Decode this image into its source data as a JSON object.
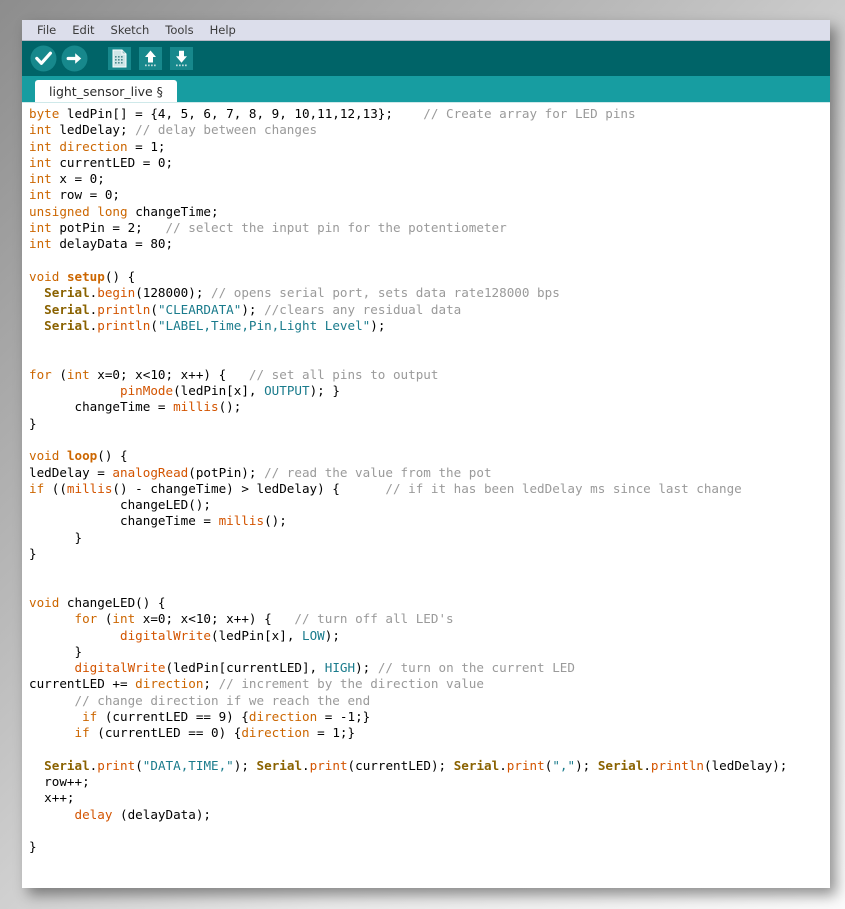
{
  "window": {
    "app": "Arduino IDE",
    "colors": {
      "toolbar_bg": "#006468",
      "tabbar_bg": "#179da1",
      "menubar_bg": "#dcdeeb",
      "editor_bg": "#ffffff",
      "keyword": "#cc6600",
      "function": "#d35400",
      "library": "#8a6200",
      "constant": "#1a7b8c",
      "string": "#1a7b8c",
      "comment": "#9a9a9a"
    }
  },
  "menubar": {
    "items": [
      {
        "label": "File"
      },
      {
        "label": "Edit"
      },
      {
        "label": "Sketch"
      },
      {
        "label": "Tools"
      },
      {
        "label": "Help"
      }
    ]
  },
  "toolbar": {
    "buttons": [
      {
        "name": "verify-button",
        "icon": "check-circle-icon",
        "title": "Verify"
      },
      {
        "name": "upload-button",
        "icon": "arrow-right-circle-icon",
        "title": "Upload"
      },
      {
        "name": "new-button",
        "icon": "new-document-icon",
        "title": "New"
      },
      {
        "name": "open-button",
        "icon": "arrow-up-icon",
        "title": "Open"
      },
      {
        "name": "save-button",
        "icon": "arrow-down-icon",
        "title": "Save"
      }
    ]
  },
  "tabs": {
    "active_label": "light_sensor_live §",
    "active_name": "light_sensor_live",
    "modified_marker": "§"
  },
  "code": {
    "language": "arduino",
    "lines": [
      "byte ledPin[] = {4, 5, 6, 7, 8, 9, 10,11,12,13};    // Create array for LED pins",
      "int ledDelay; // delay between changes",
      "int direction = 1;",
      "int currentLED = 0;",
      "int x = 0;",
      "int row = 0;",
      "unsigned long changeTime;",
      "int potPin = 2;   // select the input pin for the potentiometer",
      "int delayData = 80;",
      "",
      "void setup() {",
      "  Serial.begin(128000); // opens serial port, sets data rate128000 bps",
      "  Serial.println(\"CLEARDATA\"); //clears any residual data",
      "  Serial.println(\"LABEL,Time,Pin,Light Level\");",
      "",
      "",
      "for (int x=0; x<10; x++) {   // set all pins to output",
      "            pinMode(ledPin[x], OUTPUT); }",
      "      changeTime = millis();",
      "}",
      "",
      "void loop() {",
      "ledDelay = analogRead(potPin); // read the value from the pot",
      "if ((millis() - changeTime) > ledDelay) {      // if it has been ledDelay ms since last change",
      "            changeLED();",
      "            changeTime = millis();",
      "      }",
      "}",
      "",
      "",
      "void changeLED() {",
      "      for (int x=0; x<10; x++) {   // turn off all LED's",
      "            digitalWrite(ledPin[x], LOW);",
      "      }",
      "      digitalWrite(ledPin[currentLED], HIGH); // turn on the current LED",
      "currentLED += direction; // increment by the direction value",
      "      // change direction if we reach the end",
      "       if (currentLED == 9) {direction = -1;}",
      "      if (currentLED == 0) {direction = 1;}",
      "",
      "  Serial.print(\"DATA,TIME,\"); Serial.print(currentLED); Serial.print(\",\"); Serial.println(ledDelay);",
      "  row++;",
      "  x++;",
      "      delay (delayData);",
      "",
      "}"
    ]
  }
}
